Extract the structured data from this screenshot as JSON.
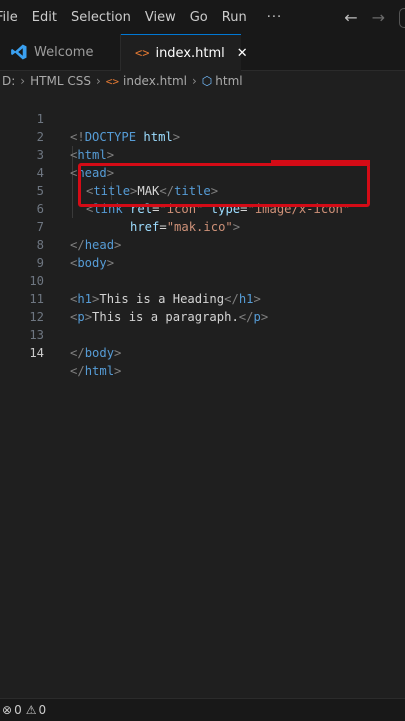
{
  "menu": {
    "items": [
      "File",
      "Edit",
      "Selection",
      "View",
      "Go",
      "Run"
    ],
    "more": "···"
  },
  "nav": {
    "back": "←",
    "forward": "→"
  },
  "tabs": [
    {
      "label": "Welcome",
      "icon": "vscode-logo-icon",
      "active": false
    },
    {
      "label": "index.html",
      "icon": "html-file-icon",
      "active": true,
      "close": "✕"
    }
  ],
  "breadcrumb": [
    "D:",
    "HTML CSS",
    "index.html",
    "html"
  ],
  "editor": {
    "lines": [
      {
        "n": "1",
        "text": "<!DOCTYPE html>"
      },
      {
        "n": "2",
        "text": "<html>"
      },
      {
        "n": "3",
        "text": "<head>"
      },
      {
        "n": "4",
        "text": "<title>MAK</title>"
      },
      {
        "n": "5",
        "text": "<link rel=\"icon\" type=\"image/x-icon\""
      },
      {
        "n": "6",
        "text": "href=\"mak.ico\">"
      },
      {
        "n": "7",
        "text": "</head>"
      },
      {
        "n": "8",
        "text": "<body>"
      },
      {
        "n": "9",
        "text": ""
      },
      {
        "n": "10",
        "text": "<h1>This is a Heading</h1>"
      },
      {
        "n": "11",
        "text": "<p>This is a paragraph.</p>"
      },
      {
        "n": "12",
        "text": ""
      },
      {
        "n": "13",
        "text": "</body>"
      },
      {
        "n": "14",
        "text": "</html>"
      }
    ],
    "active_line": "14",
    "colors": {
      "tag": "#569cd6",
      "attr": "#9cdcfe",
      "string": "#ce9178",
      "text": "#d4d4d4",
      "highlight": "#d40b16"
    }
  },
  "status": {
    "errors": "0",
    "warnings": "0"
  }
}
